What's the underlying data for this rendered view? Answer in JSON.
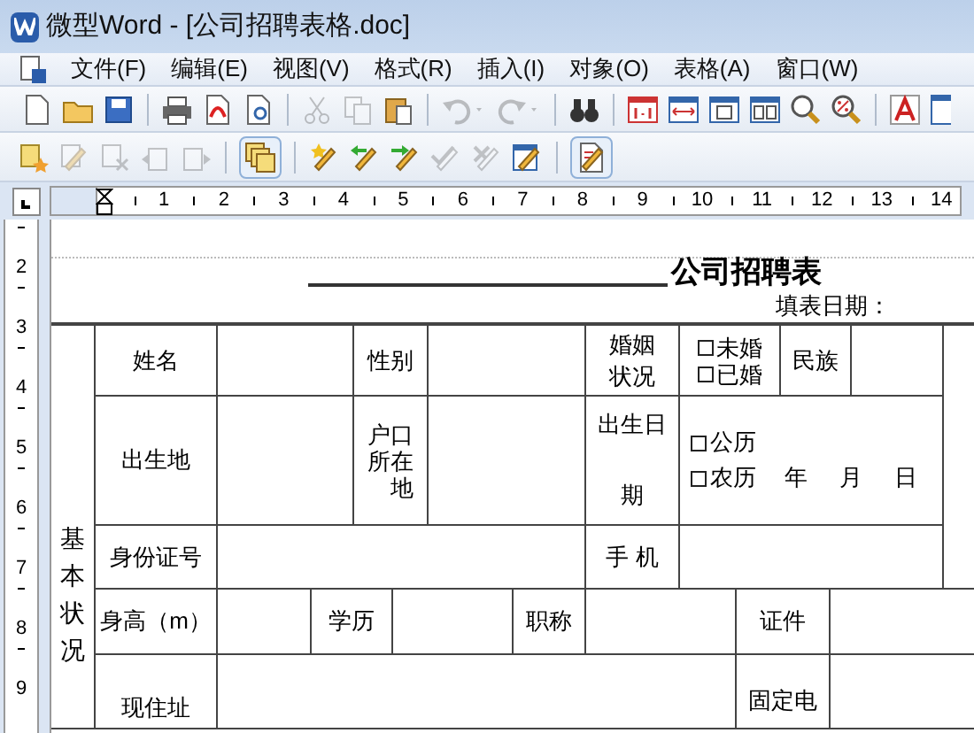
{
  "window": {
    "title": "微型Word - [公司招聘表格.doc]"
  },
  "menu": [
    "文件(F)",
    "编辑(E)",
    "视图(V)",
    "格式(R)",
    "插入(I)",
    "对象(O)",
    "表格(A)",
    "窗口(W)"
  ],
  "toolbar_1": [
    {
      "disabled": false
    },
    {
      "disabled": false
    },
    {
      "disabled": false
    },
    {
      "disabled": false
    },
    {
      "disabled": false
    },
    {
      "disabled": false
    },
    {
      "disabled": true
    },
    {
      "disabled": true
    },
    {
      "disabled": false
    },
    {
      "disabled": true
    },
    {
      "disabled": true
    },
    {
      "disabled": false
    },
    {
      "disabled": false
    },
    {
      "disabled": false
    },
    {
      "disabled": false
    },
    {
      "disabled": false
    },
    {
      "disabled": false
    },
    {
      "disabled": false
    },
    {
      "disabled": false
    },
    {
      "disabled": false
    }
  ],
  "toolbar_2": [
    {
      "disabled": false,
      "pressed": false
    },
    {
      "disabled": true,
      "pressed": false
    },
    {
      "disabled": true,
      "pressed": false
    },
    {
      "disabled": true,
      "pressed": false
    },
    {
      "disabled": true,
      "pressed": false
    },
    {
      "disabled": false,
      "pressed": true
    },
    {
      "disabled": false,
      "pressed": false
    },
    {
      "disabled": false,
      "pressed": false
    },
    {
      "disabled": false,
      "pressed": false
    },
    {
      "disabled": true,
      "pressed": false
    },
    {
      "disabled": true,
      "pressed": false
    },
    {
      "disabled": false,
      "pressed": false
    },
    {
      "disabled": false,
      "pressed": true
    }
  ],
  "ruler": {
    "marks": [
      "1",
      "2",
      "3",
      "4",
      "5",
      "6",
      "7",
      "8",
      "9",
      "10",
      "11",
      "12",
      "13",
      "14"
    ]
  },
  "vertical_ruler": {
    "marks": [
      "2",
      "3",
      "4",
      "5",
      "6",
      "7",
      "8",
      "9"
    ]
  },
  "document": {
    "title": "公司招聘表",
    "fill_date_label": "填表日期：",
    "section_label": "基本状况",
    "labels": [
      "姓名",
      "性别",
      "婚姻状况",
      "民族",
      "出生地",
      "户口所在地",
      "出生日期",
      "身份证号",
      "手 机",
      "身高（m）",
      "学历",
      "职称",
      "证件",
      "现住址",
      "固定电"
    ],
    "marital_options": [
      {
        "label": "未婚",
        "checked": false
      },
      {
        "label": "已婚",
        "checked": false
      }
    ],
    "calendar_options": [
      {
        "label": "公历",
        "checked": false
      },
      {
        "label": "农历",
        "checked": false
      }
    ],
    "date_units": [
      "年",
      "月",
      "日"
    ]
  }
}
